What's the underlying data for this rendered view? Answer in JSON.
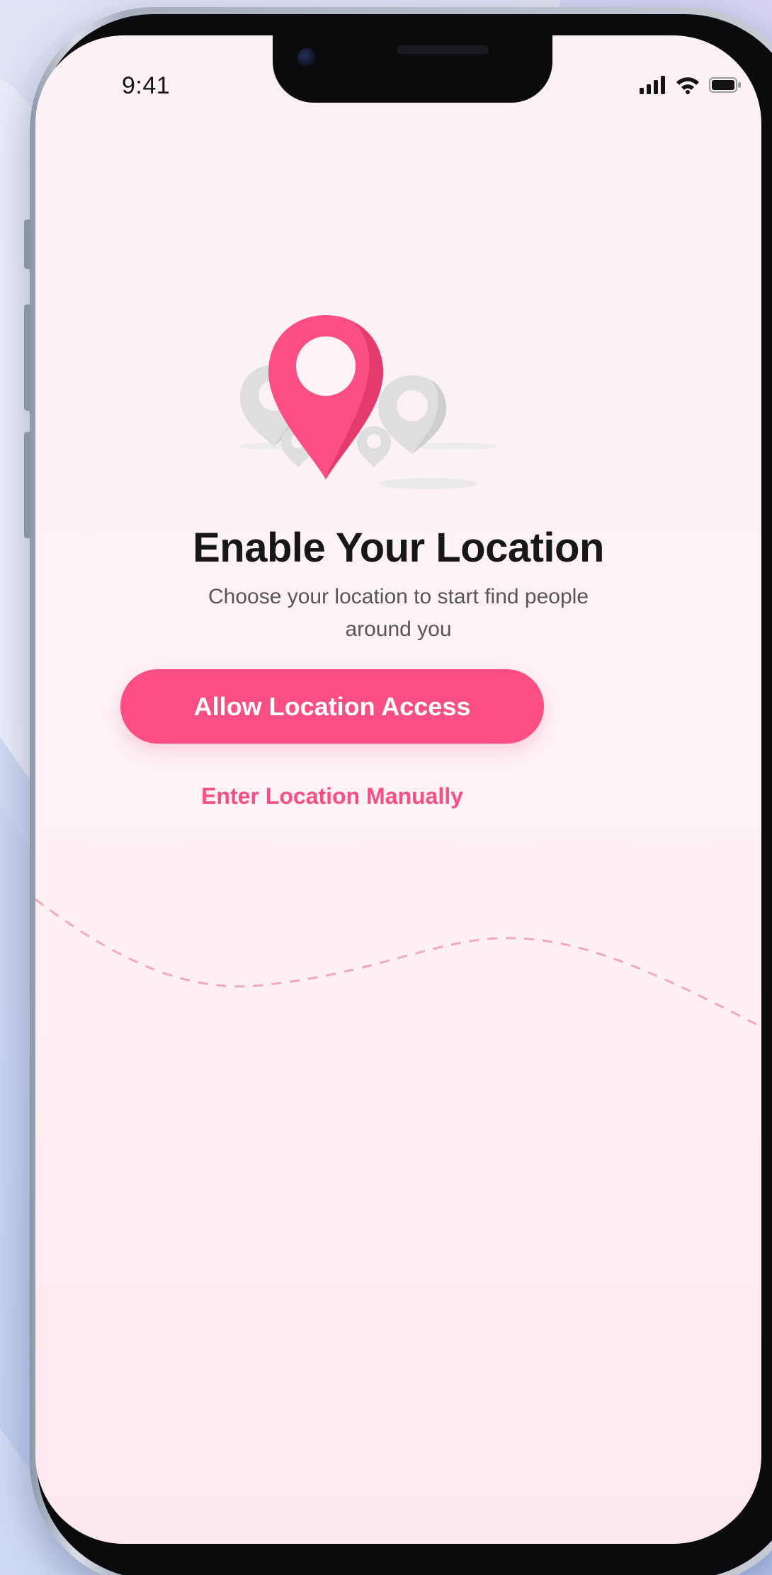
{
  "status_bar": {
    "time": "9:41",
    "icons": [
      "cellular-signal-icon",
      "wifi-icon",
      "battery-icon"
    ]
  },
  "main": {
    "illustration": "location-pins-illustration",
    "title": "Enable Your Location",
    "subtitle": "Choose your location to start find people around you",
    "primary_button": "Allow Location Access",
    "secondary_link": "Enter Location Manually"
  },
  "colors": {
    "accent": "#FB4F84",
    "pin_inactive": "#DADADA",
    "title_text": "#17171A",
    "body_text": "#55555A",
    "screen_background": "#FCF2F6"
  }
}
